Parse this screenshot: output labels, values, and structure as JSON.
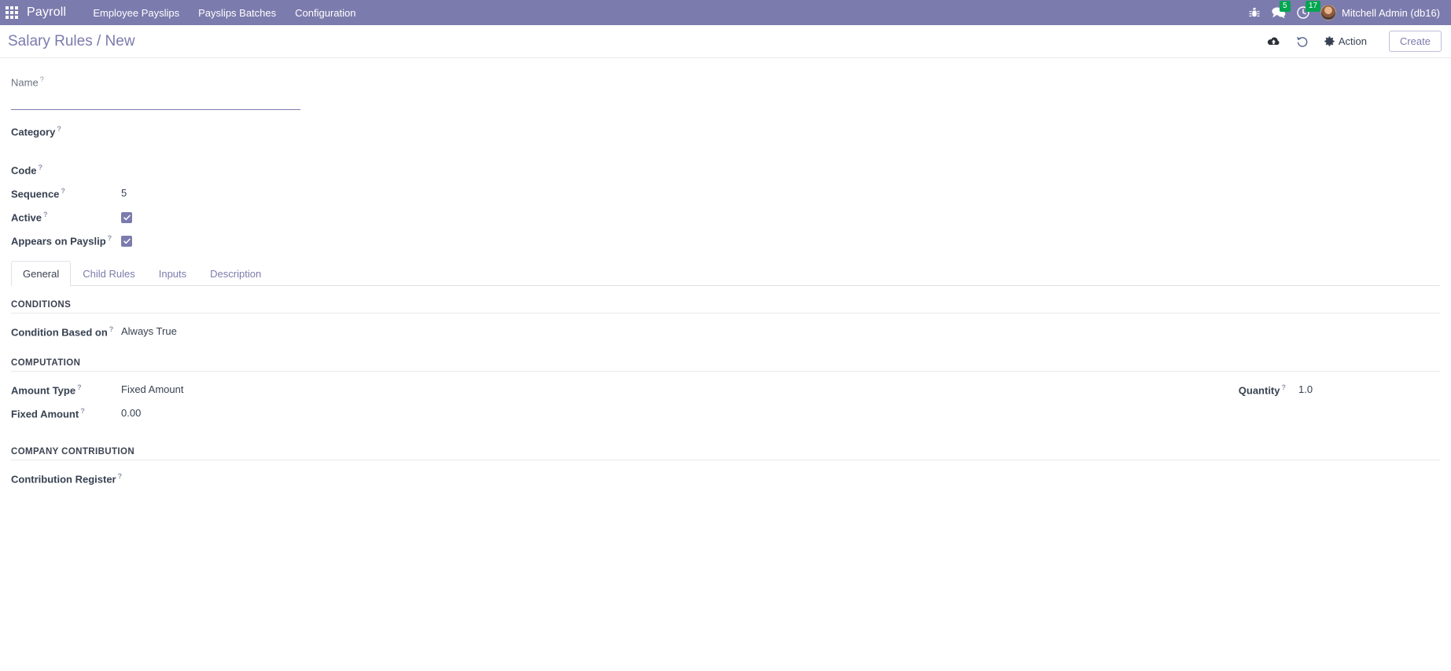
{
  "navbar": {
    "apps_icon": "apps-grid-icon",
    "brand": "Payroll",
    "menu_items": [
      {
        "label": "Employee Payslips"
      },
      {
        "label": "Payslips Batches"
      },
      {
        "label": "Configuration"
      }
    ],
    "debug_icon": "bug-icon",
    "messages": {
      "icon": "comments-icon",
      "count": "5"
    },
    "activities": {
      "icon": "clock-icon",
      "count": "17"
    },
    "user": {
      "avatar": "user-avatar",
      "name": "Mitchell Admin (db16)"
    }
  },
  "control_panel": {
    "breadcrumb": "Salary Rules / New",
    "save_icon": "cloud-upload-icon",
    "discard_icon": "undo-icon",
    "action_label": "Action",
    "action_icon": "gear-icon",
    "create_label": "Create"
  },
  "form": {
    "name": {
      "label": "Name",
      "value": "",
      "placeholder": ""
    },
    "category": {
      "label": "Category",
      "value": ""
    },
    "code": {
      "label": "Code",
      "value": ""
    },
    "sequence": {
      "label": "Sequence",
      "value": "5"
    },
    "active": {
      "label": "Active",
      "checked": true
    },
    "appears_on_payslip": {
      "label": "Appears on Payslip",
      "checked": true
    },
    "help_mark": "?"
  },
  "tabs": [
    {
      "label": "General",
      "active": true
    },
    {
      "label": "Child Rules",
      "active": false
    },
    {
      "label": "Inputs",
      "active": false
    },
    {
      "label": "Description",
      "active": false
    }
  ],
  "general_tab": {
    "conditions": {
      "title": "CONDITIONS",
      "condition_based_on": {
        "label": "Condition Based on",
        "value": "Always True"
      }
    },
    "computation": {
      "title": "COMPUTATION",
      "amount_type": {
        "label": "Amount Type",
        "value": "Fixed Amount"
      },
      "fixed_amount": {
        "label": "Fixed Amount",
        "value": "0.00"
      },
      "quantity": {
        "label": "Quantity",
        "value": "1.0"
      }
    },
    "company_contribution": {
      "title": "COMPANY CONTRIBUTION",
      "contribution_register": {
        "label": "Contribution Register",
        "value": ""
      }
    }
  },
  "colors": {
    "brand_purple": "#7c7bad",
    "badge_green": "#00a54f",
    "text_dark": "#374151"
  }
}
